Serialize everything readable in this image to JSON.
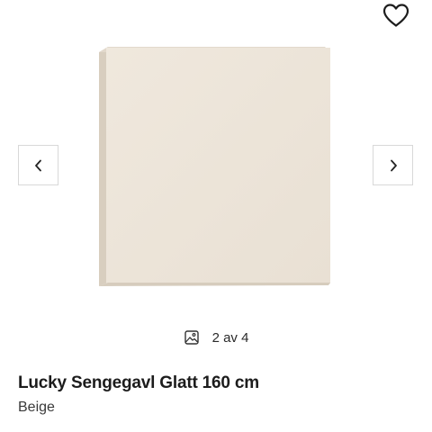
{
  "gallery": {
    "image_alt": "Lucky Sengegavl Glatt 160 cm",
    "current": "2 av 4",
    "prev_icon": "chevron-left-icon",
    "next_icon": "chevron-right-icon",
    "counter_icon": "image-icon"
  },
  "favorite": {
    "icon": "heart-icon"
  },
  "product": {
    "title": "Lucky Sengegavl Glatt 160 cm",
    "variant": "Beige"
  },
  "colors": {
    "headboard_face": "#ece4d8",
    "headboard_edge": "#d9cfc0",
    "text_primary": "#1c1c1c",
    "border": "#d8d8d8"
  }
}
